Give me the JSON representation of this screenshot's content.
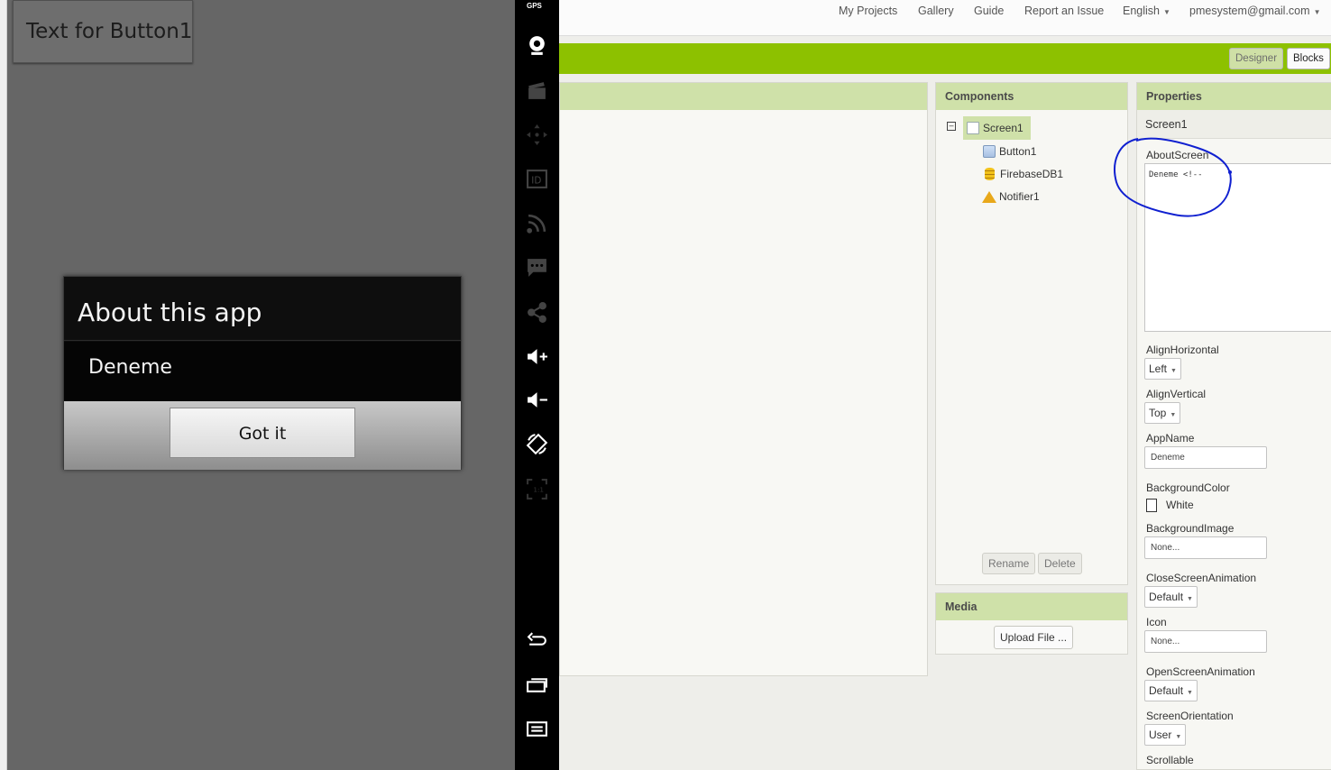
{
  "topnav": {
    "my_projects": "My Projects",
    "gallery": "Gallery",
    "guide": "Guide",
    "report_issue": "Report an Issue",
    "language": "English",
    "account": "pmesystem@gmail.com"
  },
  "toolbar": {
    "designer": "Designer",
    "blocks": "Blocks"
  },
  "components": {
    "title": "Components",
    "tree": [
      {
        "label": "Screen1",
        "icon": "screen-icon"
      },
      {
        "label": "Button1",
        "icon": "button-icon"
      },
      {
        "label": "FirebaseDB1",
        "icon": "database-icon"
      },
      {
        "label": "Notifier1",
        "icon": "warning-icon"
      }
    ],
    "rename": "Rename",
    "delete": "Delete"
  },
  "media": {
    "title": "Media",
    "upload": "Upload File ..."
  },
  "properties": {
    "title": "Properties",
    "screen": "Screen1",
    "about_label": "AboutScreen",
    "about_value": "Deneme <!--",
    "align_h_label": "AlignHorizontal",
    "align_h_value": "Left",
    "align_v_label": "AlignVertical",
    "align_v_value": "Top",
    "appname_label": "AppName",
    "appname_value": "Deneme",
    "bgcolor_label": "BackgroundColor",
    "bgcolor_value": "White",
    "bgimage_label": "BackgroundImage",
    "bgimage_value": "None...",
    "close_anim_label": "CloseScreenAnimation",
    "close_anim_value": "Default",
    "icon_label": "Icon",
    "icon_value": "None...",
    "open_anim_label": "OpenScreenAnimation",
    "open_anim_value": "Default",
    "orientation_label": "ScreenOrientation",
    "orientation_value": "User",
    "scrollable_label": "Scrollable"
  },
  "emulator": {
    "app_button_text": "Text for Button1",
    "dialog_title": "About this app",
    "dialog_message": "Deneme",
    "dialog_button": "Got it",
    "gps_label": "GPS",
    "sidebar_icons": [
      "webcam-icon",
      "camera-clapper-icon",
      "dpad-icon",
      "id-icon",
      "rss-icon",
      "sms-icon",
      "share-icon",
      "volume-up-icon",
      "volume-down-icon",
      "rotate-icon",
      "scale-icon",
      "back-icon",
      "recent-apps-icon",
      "menu-icon"
    ]
  },
  "colors": {
    "accent_green": "#8dc100",
    "panel_header": "#cfe1a9",
    "annotation": "#1020d0"
  }
}
